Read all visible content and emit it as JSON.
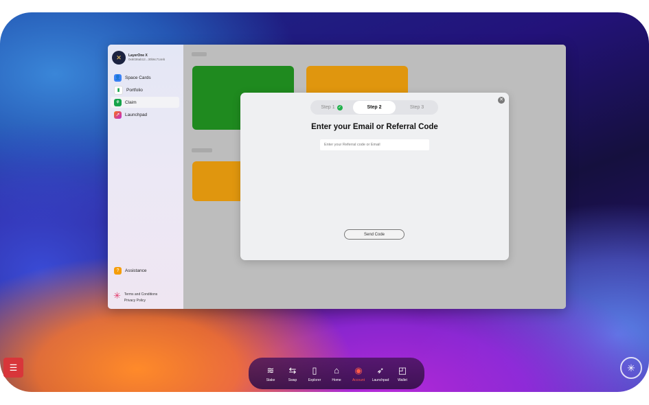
{
  "profile": {
    "name": "LayerOne X",
    "address": "0x6036ab12...30b6c714eb"
  },
  "sidebar": {
    "items": [
      {
        "label": "Space Cards",
        "icon": "user-icon",
        "color": "#3b82f6"
      },
      {
        "label": "Portfolio",
        "icon": "bar-chart-icon",
        "color": "#f4f4f4"
      },
      {
        "label": "Claim",
        "icon": "claim-icon",
        "color": "#16a34a"
      },
      {
        "label": "Launchpad",
        "icon": "rocket-icon",
        "color": "#c026d3"
      }
    ],
    "assistance": "Assistance",
    "terms": "Terms and Conditions",
    "privacy": "Privacy Policy"
  },
  "modal": {
    "steps": [
      "Step 1",
      "Step 2",
      "Step 3"
    ],
    "active_step": "Step 2",
    "title": "Enter your Email or Referral Code",
    "input_placeholder": "Enter your Referral code or Email",
    "send_label": "Send Code"
  },
  "dock": {
    "items": [
      {
        "label": "Stake",
        "icon": "layers-icon"
      },
      {
        "label": "Swap",
        "icon": "swap-icon"
      },
      {
        "label": "Explorer",
        "icon": "explorer-icon"
      },
      {
        "label": "Home",
        "icon": "home-icon"
      },
      {
        "label": "Account",
        "icon": "account-icon",
        "active": true
      },
      {
        "label": "Launchpad",
        "icon": "rocket-icon"
      },
      {
        "label": "Wallet",
        "icon": "wallet-icon"
      }
    ]
  },
  "colors": {
    "accent": "#ff5a4a",
    "claim_green": "#1f8a1f",
    "card_orange": "#e0960e",
    "menu_red": "#d8363a"
  }
}
